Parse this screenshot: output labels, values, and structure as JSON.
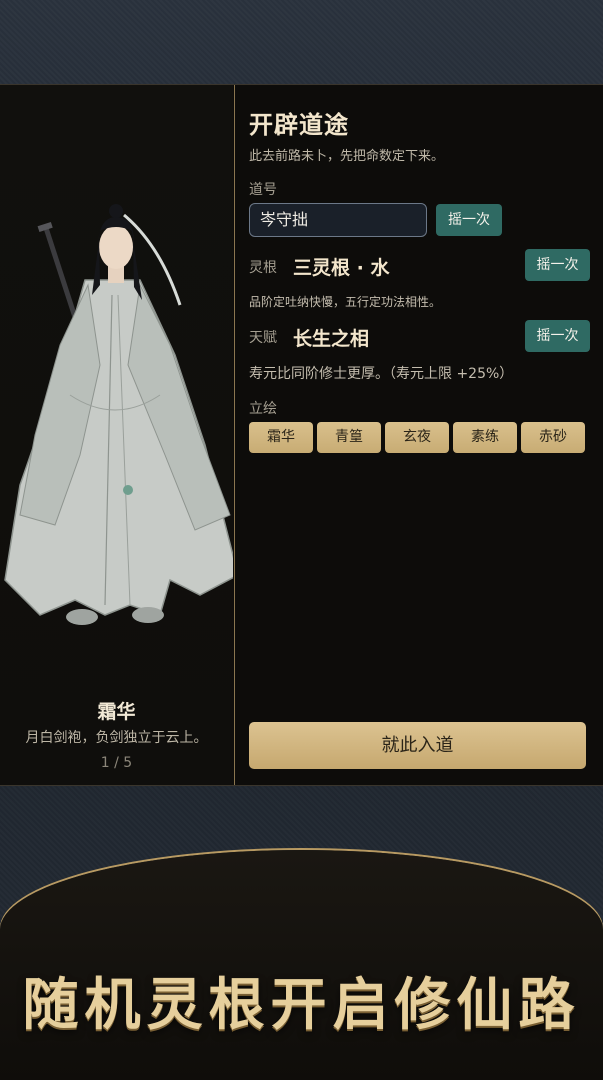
{
  "character": {
    "name": "霜华",
    "description": "月白剑袍，负剑独立于云上。",
    "page": "1 / 5"
  },
  "form": {
    "title": "开辟道途",
    "subtitle": "此去前路未卜，先把命数定下来。",
    "dao_name_label": "道号",
    "dao_name_value": "岑守拙",
    "reroll_label": "摇一次",
    "spirit_root_label": "灵根",
    "spirit_root_value": "三灵根 · 水",
    "spirit_root_note": "品阶定吐纳快慢，五行定功法相性。",
    "talent_label": "天赋",
    "talent_value": "长生之相",
    "talent_note": "寿元比同阶修士更厚。（寿元上限 +25%）",
    "portrait_label": "立绘",
    "portraits": [
      "霜华",
      "青篁",
      "玄夜",
      "素练",
      "赤砂"
    ],
    "enter_button": "就此入道"
  },
  "slogan": "随机灵根开启修仙路",
  "colors": {
    "accent_teal": "#2f6a63",
    "gold": "#d4b97f",
    "panel_bg": "#0d0c0a"
  }
}
